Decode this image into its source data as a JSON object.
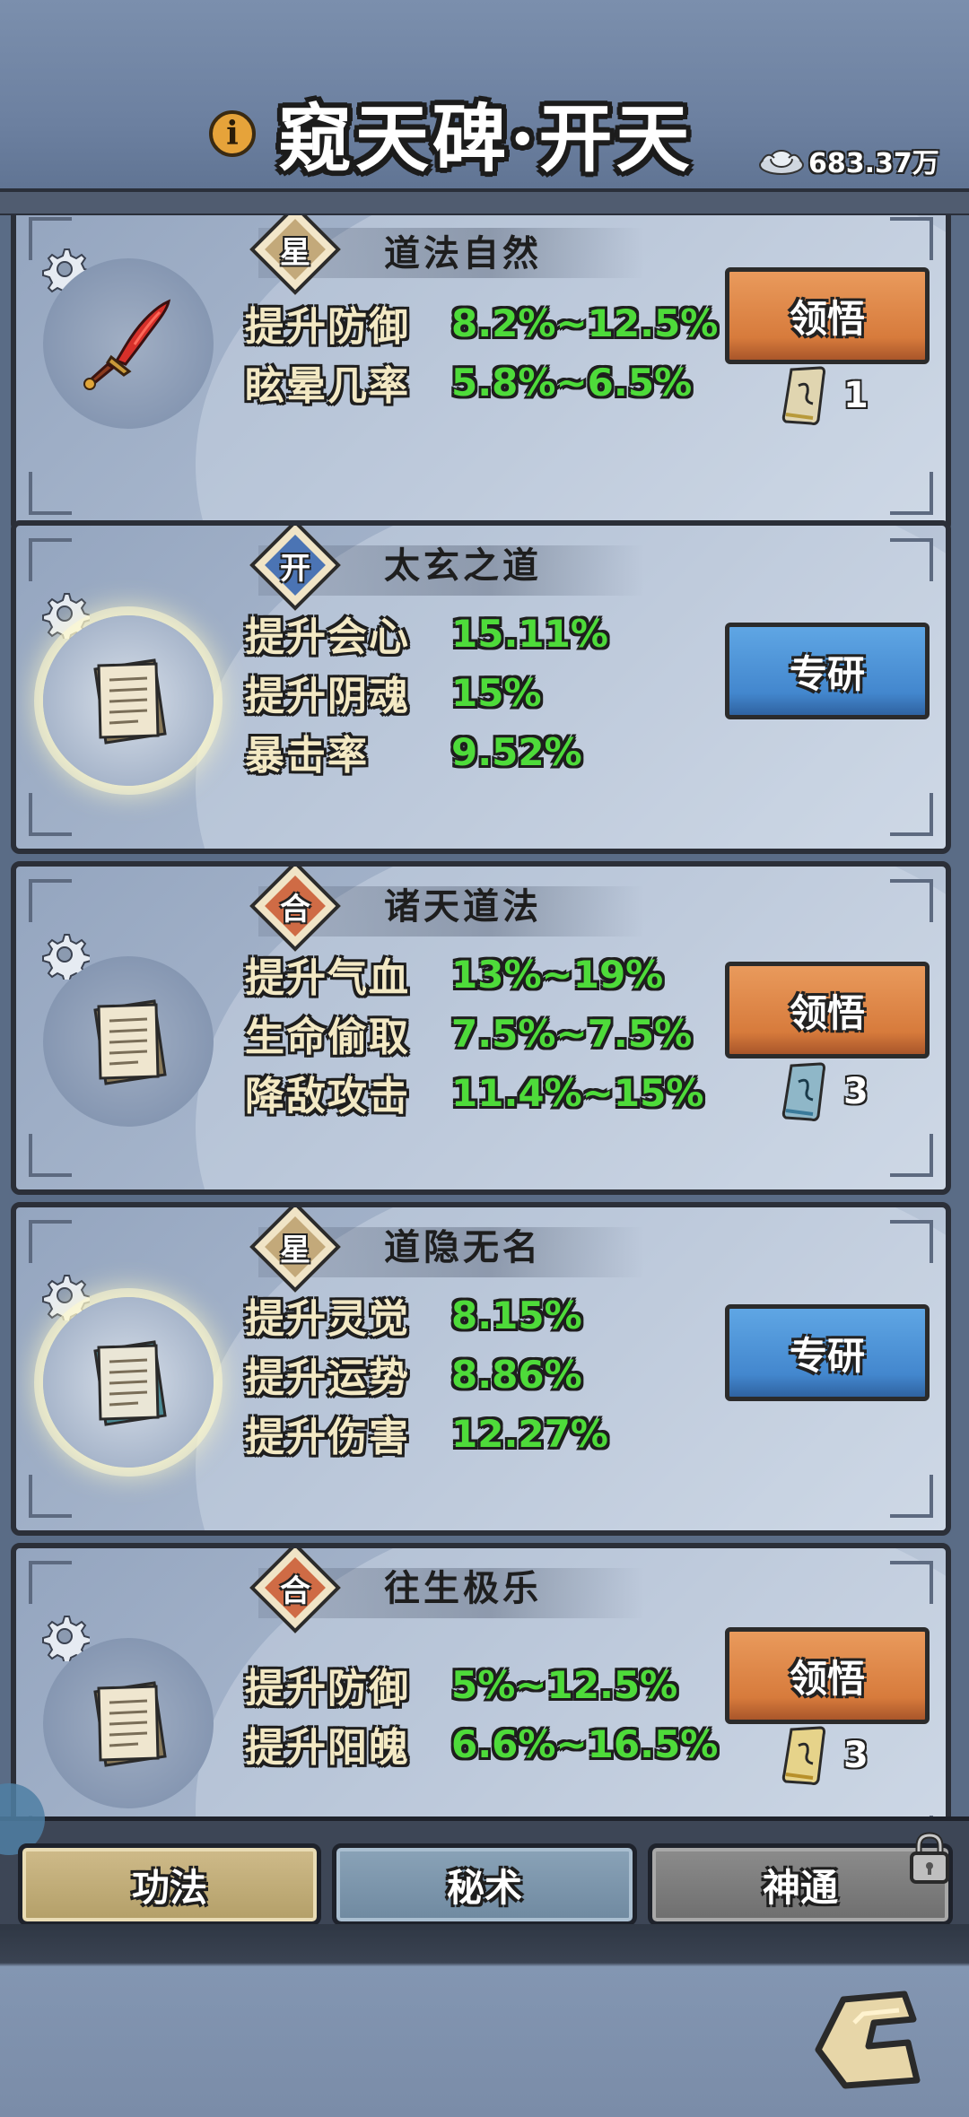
{
  "header": {
    "title": "窥天碑·开天",
    "info_icon": "info-icon",
    "currency_icon": "silver-ingot-icon",
    "currency_value": "683.37万"
  },
  "cards": [
    {
      "rank": "星",
      "rank_color": "#c3a97a",
      "name": "道法自然",
      "item_icon": "red-sword-icon",
      "glow": false,
      "stats": [
        {
          "label": "提升防御",
          "value": "8.2%~12.5%"
        },
        {
          "label": "眩晕几率",
          "value": "5.8%~6.5%"
        }
      ],
      "button": {
        "label": "领悟",
        "style": "orange"
      },
      "cost": {
        "icon": "gold-scroll-icon",
        "count": "1"
      }
    },
    {
      "rank": "开",
      "rank_color": "#4b74b4",
      "name": "太玄之道",
      "item_icon": "paper-scroll-icon",
      "glow": true,
      "stats": [
        {
          "label": "提升会心",
          "value": "15.11%"
        },
        {
          "label": "提升阴魂",
          "value": "15%"
        },
        {
          "label": "暴击率",
          "value": "9.52%"
        }
      ],
      "button": {
        "label": "专研",
        "style": "blue"
      }
    },
    {
      "rank": "合",
      "rank_color": "#cf6b45",
      "name": "诸天道法",
      "item_icon": "paper-scroll-icon",
      "glow": false,
      "stats": [
        {
          "label": "提升气血",
          "value": "13%~19%"
        },
        {
          "label": "生命偷取",
          "value": "7.5%~7.5%"
        },
        {
          "label": "降敌攻击",
          "value": "11.4%~15%"
        }
      ],
      "button": {
        "label": "领悟",
        "style": "orange"
      },
      "cost": {
        "icon": "blue-scroll-icon",
        "count": "3"
      }
    },
    {
      "rank": "星",
      "rank_color": "#c3a97a",
      "name": "道隐无名",
      "item_icon": "teal-paper-scroll-icon",
      "glow": true,
      "stats": [
        {
          "label": "提升灵觉",
          "value": "8.15%"
        },
        {
          "label": "提升运势",
          "value": "8.86%"
        },
        {
          "label": "提升伤害",
          "value": "12.27%"
        }
      ],
      "button": {
        "label": "专研",
        "style": "blue"
      }
    },
    {
      "rank": "合",
      "rank_color": "#cf6b45",
      "name": "往生极乐",
      "item_icon": "paper-scroll-icon",
      "glow": false,
      "stats": [
        {
          "label": "提升防御",
          "value": "5%~12.5%"
        },
        {
          "label": "提升阳魄",
          "value": "6.6%~16.5%"
        }
      ],
      "button": {
        "label": "领悟",
        "style": "orange"
      },
      "cost": {
        "icon": "gold-scroll-icon",
        "count": "3"
      }
    }
  ],
  "tabs": [
    {
      "label": "功法",
      "state": "active"
    },
    {
      "label": "秘术",
      "state": "inactive"
    },
    {
      "label": "神通",
      "state": "locked"
    }
  ],
  "footer": {
    "back_icon": "return-arrow-icon"
  }
}
